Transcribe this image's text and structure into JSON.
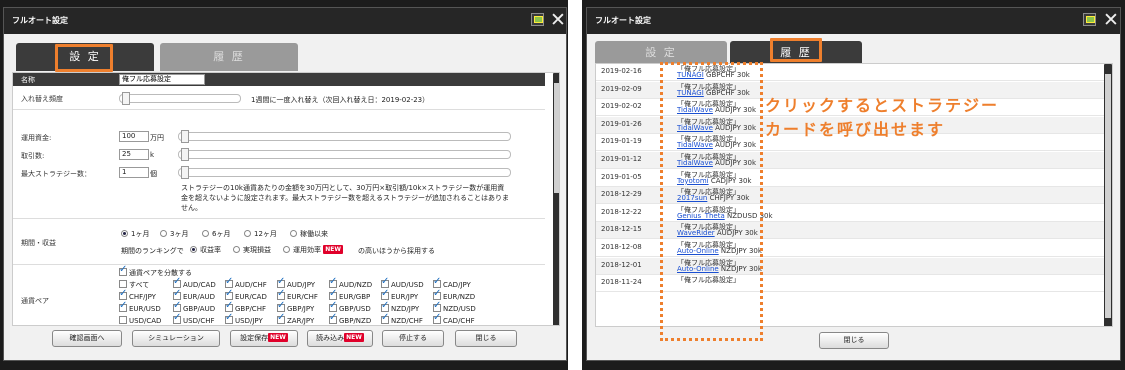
{
  "left": {
    "title": "フルオート設定",
    "tabs": [
      "設 定",
      "履 歴"
    ],
    "header_label": "名称",
    "name_value": "俺フル応募設定",
    "rows": {
      "rebalance_label": "入れ替え頻度",
      "rebalance_text": "1週間に一度入れ替え（次回入れ替え日：2019-02-23）",
      "capital_label": "運用資金:",
      "capital_value": "100",
      "capital_unit": "万円",
      "lots_label": "取引数:",
      "lots_value": "25",
      "lots_unit": "k",
      "max_label": "最大ストラテジー数：",
      "max_value": "1",
      "max_unit": "個",
      "note": "ストラテジーの10k通貨あたりの金額を30万円として、30万円×取引額/10k×ストラテジー数が運用資金を超えないように設定されます。最大ストラテジー数を超えるストラテジーが追加されることはありません。"
    },
    "period": {
      "label": "期間・収益",
      "options": [
        "1ヶ月",
        "3ヶ月",
        "6ヶ月",
        "12ヶ月",
        "稼働以来"
      ],
      "selected": 0,
      "rank_prefix": "期間のランキングで",
      "rank_options": [
        "収益率",
        "実現損益",
        "運用効率"
      ],
      "rank_selected": 0,
      "new_badge": "NEW",
      "rank_suffix": "の高いほうから採用する"
    },
    "pairs": {
      "label": "通貨ペア",
      "split_label": "通貨ペアを分散する",
      "all_label": "すべて",
      "rows": [
        [
          {
            "t": "AUD/CAD",
            "c": true
          },
          {
            "t": "AUD/CHF",
            "c": true
          },
          {
            "t": "AUD/JPY",
            "c": true
          },
          {
            "t": "AUD/NZD",
            "c": true
          },
          {
            "t": "AUD/USD",
            "c": true
          },
          {
            "t": "CAD/JPY",
            "c": true
          }
        ],
        [
          {
            "t": "CHF/JPY",
            "c": true
          },
          {
            "t": "EUR/AUD",
            "c": true
          },
          {
            "t": "EUR/CAD",
            "c": true
          },
          {
            "t": "EUR/CHF",
            "c": true
          },
          {
            "t": "EUR/GBP",
            "c": true
          },
          {
            "t": "EUR/JPY",
            "c": true
          },
          {
            "t": "EUR/NZD",
            "c": true
          }
        ],
        [
          {
            "t": "EUR/USD",
            "c": true
          },
          {
            "t": "GBP/AUD",
            "c": true
          },
          {
            "t": "GBP/CHF",
            "c": true
          },
          {
            "t": "GBP/JPY",
            "c": true
          },
          {
            "t": "GBP/USD",
            "c": true
          },
          {
            "t": "NZD/JPY",
            "c": true
          },
          {
            "t": "NZD/USD",
            "c": true
          }
        ],
        [
          {
            "t": "USD/CAD",
            "c": false
          },
          {
            "t": "USD/CHF",
            "c": true
          },
          {
            "t": "USD/JPY",
            "c": true
          },
          {
            "t": "ZAR/JPY",
            "c": true
          },
          {
            "t": "GBP/NZD",
            "c": true
          },
          {
            "t": "NZD/CHF",
            "c": true
          },
          {
            "t": "CAD/CHF",
            "c": true
          }
        ]
      ]
    },
    "buttons": {
      "confirm": "確認画面へ",
      "simulation": "シミュレーション",
      "save": "設定保存",
      "load": "読み込み",
      "new": "NEW",
      "stop": "停止する",
      "close": "閉じる"
    }
  },
  "right": {
    "title": "フルオート設定",
    "tabs": [
      "設 定",
      "履 歴"
    ],
    "history": [
      {
        "date": "2019-02-16",
        "name": "「俺フル応募設定」",
        "link": "TUNAGI",
        "pair": "GBPCHF 30k"
      },
      {
        "date": "2019-02-09",
        "name": "「俺フル応募設定」",
        "link": "TUNAGI",
        "pair": "GBPCHF 30k"
      },
      {
        "date": "2019-02-02",
        "name": "「俺フル応募設定」",
        "link": "TidalWave",
        "pair": "AUDJPY 30k"
      },
      {
        "date": "2019-01-26",
        "name": "「俺フル応募設定」",
        "link": "TidalWave",
        "pair": "AUDJPY 30k"
      },
      {
        "date": "2019-01-19",
        "name": "「俺フル応募設定」",
        "link": "TidalWave",
        "pair": "AUDJPY 30k"
      },
      {
        "date": "2019-01-12",
        "name": "「俺フル応募設定」",
        "link": "TidalWave",
        "pair": "AUDJPY 30k"
      },
      {
        "date": "2019-01-05",
        "name": "「俺フル応募設定」",
        "link": "Toyotomi",
        "pair": "CADJPY 30k"
      },
      {
        "date": "2018-12-29",
        "name": "「俺フル応募設定」",
        "link": "2017sun",
        "pair": "CHFJPY 30k"
      },
      {
        "date": "2018-12-22",
        "name": "「俺フル応募設定」",
        "link": "Genius_Theta",
        "pair": "NZDUSD 30k"
      },
      {
        "date": "2018-12-15",
        "name": "「俺フル応募設定」",
        "link": "WaveRider",
        "pair": "AUDJPY 30k"
      },
      {
        "date": "2018-12-08",
        "name": "「俺フル応募設定」",
        "link": "Auto-Online",
        "pair": "NZDJPY 30k"
      },
      {
        "date": "2018-12-01",
        "name": "「俺フル応募設定」",
        "link": "Auto-Online",
        "pair": "NZDJPY 30k"
      },
      {
        "date": "2018-11-24",
        "name": "「俺フル応募設定」",
        "link": "",
        "pair": ""
      }
    ],
    "callout_line1": "クリックするとストラテジー",
    "callout_line2": "カードを呼び出せます",
    "close_button": "閉じる"
  },
  "colors": {
    "accent": "#ee7f2d",
    "titlebar": "#262626",
    "link": "#1a4fd1",
    "new_badge": "#e0002a"
  }
}
